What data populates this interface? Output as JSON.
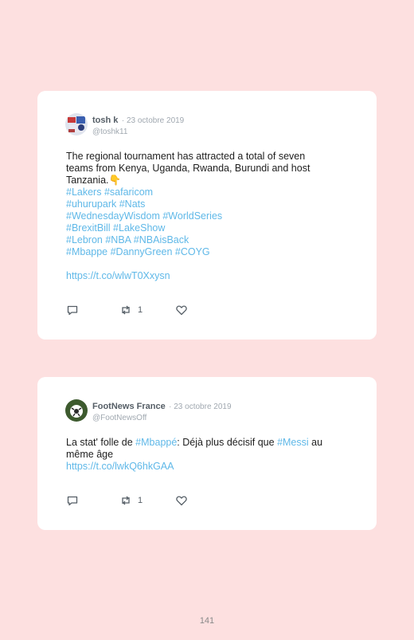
{
  "tweets": [
    {
      "name": "tosh k",
      "date": "· 23 octobre 2019",
      "handle": "@toshk11",
      "text_lines": [
        "The regional tournament has attracted a total of seven",
        "teams from Kenya, Uganda, Rwanda, Burundi and host",
        "Tanzania."
      ],
      "emoji": "👇",
      "hashtag_lines": [
        "#Lakers #safaricom",
        "#uhurupark #Nats",
        "#WednesdayWisdom #WorldSeries",
        "#BrexitBill #LakeShow",
        "#Lebron #NBA #NBAisBack",
        "#Mbappe #DannyGreen #COYG"
      ],
      "link": "https://t.co/wlwT0Xxysn",
      "retweets": "1",
      "icons": [
        "reply-icon",
        "retweet-icon",
        "like-icon"
      ]
    },
    {
      "name": "FootNews France",
      "date": "· 23 octobre 2019",
      "handle": "@FootNewsOff",
      "text_1": "La stat' folle de ",
      "tag_1": "#Mbappé",
      "text_2": ": Déjà plus décisif que ",
      "tag_2": "#Messi",
      "text_3": " au",
      "text_line2": "même âge",
      "link": "https://t.co/lwkQ6hkGAA",
      "retweets": "1",
      "icons": [
        "reply-icon",
        "retweet-icon",
        "like-icon"
      ]
    }
  ],
  "page_number": "141",
  "colors": {
    "background": "#fde0e0",
    "card": "#ffffff",
    "hashtag": "#5fb8e8",
    "text": "#1e1e1e",
    "muted": "#a0a8b0"
  }
}
